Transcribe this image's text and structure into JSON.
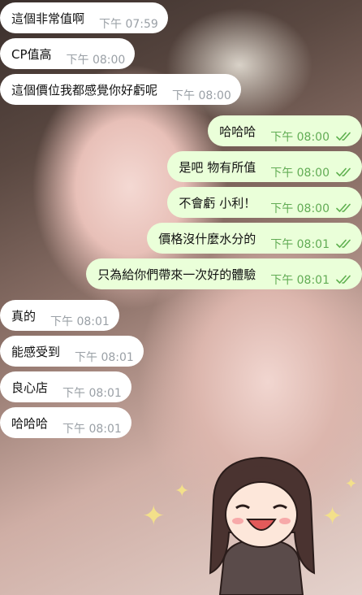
{
  "messages": [
    {
      "dir": "in",
      "text": "這個非常值啊",
      "time": "下午 07:59"
    },
    {
      "dir": "in",
      "text": "CP值高",
      "time": "下午 08:00"
    },
    {
      "dir": "in",
      "text": "這個價位我都感覺你好虧呢",
      "time": "下午 08:00"
    },
    {
      "dir": "out",
      "text": "哈哈哈",
      "time": "下午 08:00",
      "read": true
    },
    {
      "dir": "out",
      "text": "是吧 物有所值",
      "time": "下午 08:00",
      "read": true
    },
    {
      "dir": "out",
      "text": "不會虧 小利！",
      "time": "下午 08:00",
      "read": true
    },
    {
      "dir": "out",
      "text": "價格沒什麼水分的",
      "time": "下午 08:01",
      "read": true
    },
    {
      "dir": "out",
      "text": "只為給你們帶來一次好的體驗",
      "time": "下午 08:01",
      "read": true
    },
    {
      "dir": "in",
      "text": "真的",
      "time": "下午 08:01"
    },
    {
      "dir": "in",
      "text": "能感受到",
      "time": "下午 08:01"
    },
    {
      "dir": "in",
      "text": "良心店",
      "time": "下午 08:01"
    },
    {
      "dir": "in",
      "text": "哈哈哈",
      "time": "下午 08:01"
    }
  ],
  "colors": {
    "incoming_bubble": "#ffffff",
    "outgoing_bubble": "#eaffd9",
    "outgoing_time": "#62ac55",
    "incoming_time": "#9aa0a6",
    "read_ticks": "#5fb04f"
  },
  "wallpaper": {
    "sticker_icon": "chibi-girl-sticker",
    "sparkle_icon": "sparkle-icon"
  }
}
